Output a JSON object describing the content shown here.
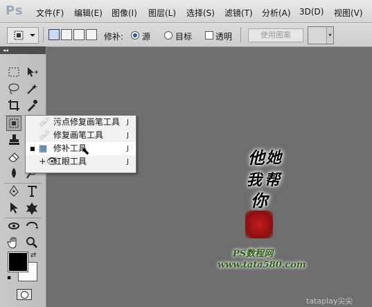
{
  "app": {
    "logo": "Ps"
  },
  "menubar": {
    "items": [
      "文件(F)",
      "编辑(E)",
      "图像(I)",
      "图层(L)",
      "选择(S)",
      "滤镜(T)",
      "分析(A)",
      "3D(D)",
      "视图(V)"
    ]
  },
  "options": {
    "patch_label": "修补:",
    "source_label": "源",
    "destination_label": "目标",
    "transparent_label": "透明",
    "use_pattern_label": "使用图案",
    "patch_mode": "source",
    "transparent_checked": false
  },
  "toolbox": {
    "collapse_label": "◂◂",
    "tools": [
      "rectangular-marquee",
      "move",
      "lasso",
      "magic-wand",
      "crop",
      "eyedropper",
      "patch",
      "brush",
      "clone-stamp",
      "history-brush",
      "eraser",
      "gradient",
      "blur",
      "dodge",
      "pen",
      "type",
      "path-selection",
      "custom-shape",
      "3d-rotate",
      "3d-orbit",
      "hand",
      "zoom"
    ],
    "foreground_color": "#000000",
    "background_color": "#ffffff"
  },
  "flyout": {
    "items": [
      {
        "label": "污点修复画笔工具",
        "shortcut": "J",
        "icon": "spot-healing-brush-icon",
        "selected": false
      },
      {
        "label": "修复画笔工具",
        "shortcut": "J",
        "icon": "healing-brush-icon",
        "selected": false
      },
      {
        "label": "修补工具",
        "shortcut": "J",
        "icon": "patch-icon",
        "selected": true
      },
      {
        "label": "红眼工具",
        "shortcut": "J",
        "icon": "red-eye-icon",
        "selected": false
      }
    ]
  },
  "canvas": {
    "background": "#6e6e6e",
    "signature_lines": [
      "他",
      "她",
      "我",
      "帮",
      "你"
    ],
    "watermark_line1": "PS数程网",
    "watermark_line2": "www.tata580.com",
    "corner_watermark": "tataplay尖尖"
  }
}
